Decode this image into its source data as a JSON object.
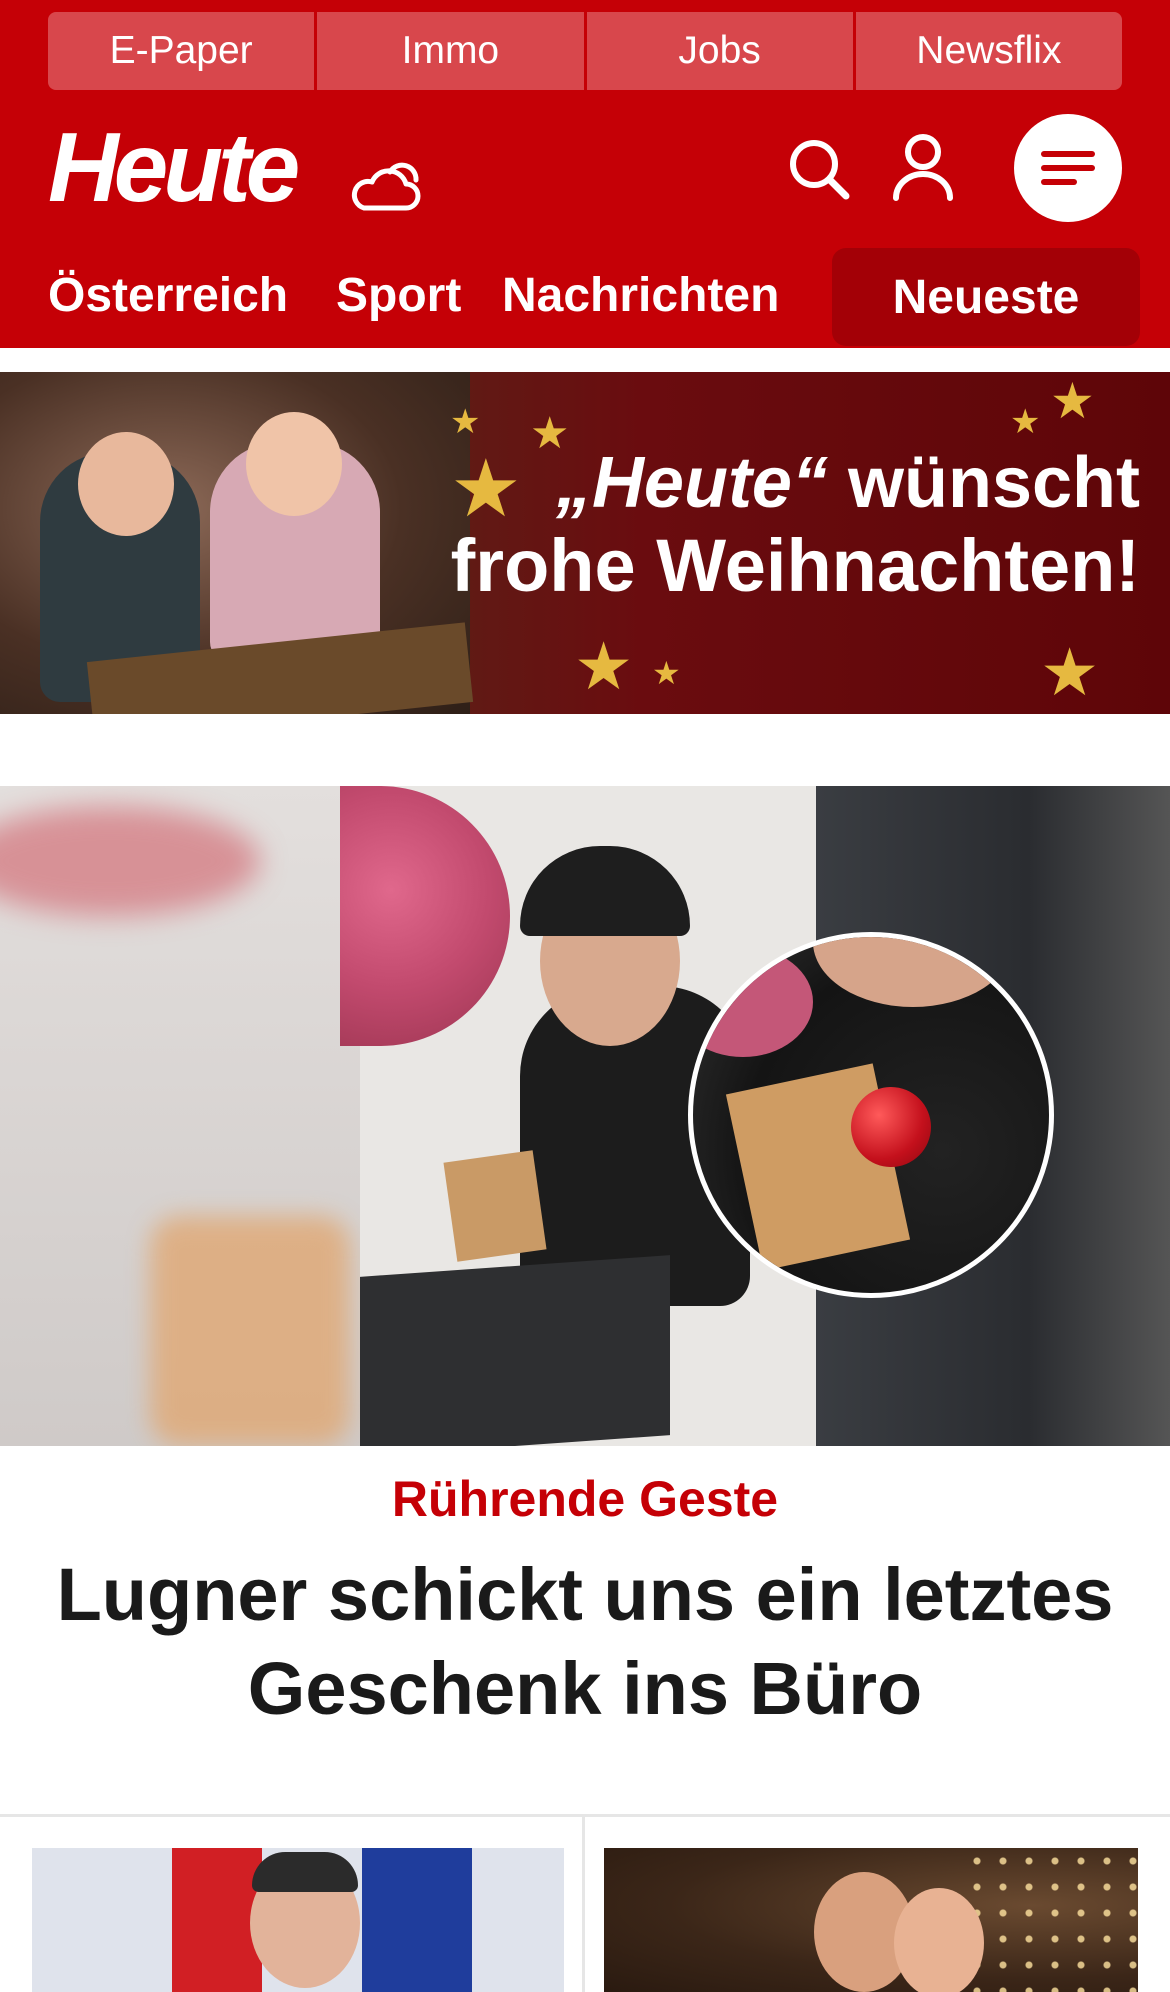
{
  "quick_links": [
    "E-Paper",
    "Immo",
    "Jobs",
    "Newsflix"
  ],
  "brand": {
    "logo_text": "Heute"
  },
  "header_icons": {
    "weather": "cloud-sun-icon",
    "search": "search-icon",
    "account": "user-icon",
    "menu": "menu-icon"
  },
  "nav": {
    "items": [
      "Österreich",
      "Sport",
      "Nachrichten"
    ],
    "highlight": "Neueste"
  },
  "banner": {
    "brand": "„Heute“",
    "line1_rest": " wünscht",
    "line2": "frohe Weihnachten!"
  },
  "hero": {
    "kicker": "Rührende Geste",
    "headline": "Lugner schickt uns ein letztes Geschenk ins Büro"
  },
  "colors": {
    "brand_red": "#c50006",
    "dark_red": "#a30006",
    "quicklink_bg": "#d8474c",
    "banner_star": "#e6b940"
  }
}
